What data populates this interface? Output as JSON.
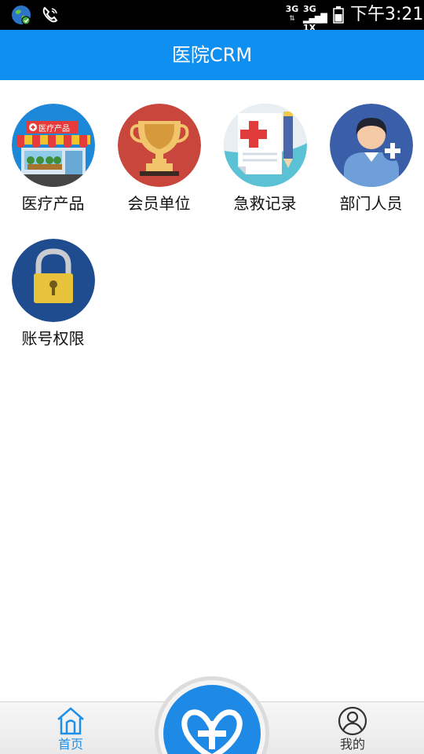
{
  "status_bar": {
    "icons": [
      "globe-icon",
      "phone-call-icon",
      "signal-3g-icon",
      "signal-3g-1x-icon",
      "battery-icon"
    ],
    "network_1": "3G",
    "network_2_top": "3G",
    "network_2_bottom": "1X",
    "time": "下午3:21"
  },
  "header": {
    "title": "医院CRM",
    "color": "#0f8ff0"
  },
  "apps": [
    {
      "label": "医疗产品",
      "icon": "medical-store-icon",
      "badge_text": "医疗产品"
    },
    {
      "label": "会员单位",
      "icon": "trophy-icon"
    },
    {
      "label": "急救记录",
      "icon": "medical-record-icon"
    },
    {
      "label": "部门人员",
      "icon": "add-user-icon"
    },
    {
      "label": "账号权限",
      "icon": "padlock-icon"
    }
  ],
  "bottom_nav": {
    "tabs": [
      {
        "label": "首页",
        "icon": "home-icon",
        "active": true
      },
      {
        "label": "我的",
        "icon": "user-icon",
        "active": false
      }
    ],
    "center_icon": "heart-cross-icon",
    "active_color": "#1d8fe8"
  }
}
